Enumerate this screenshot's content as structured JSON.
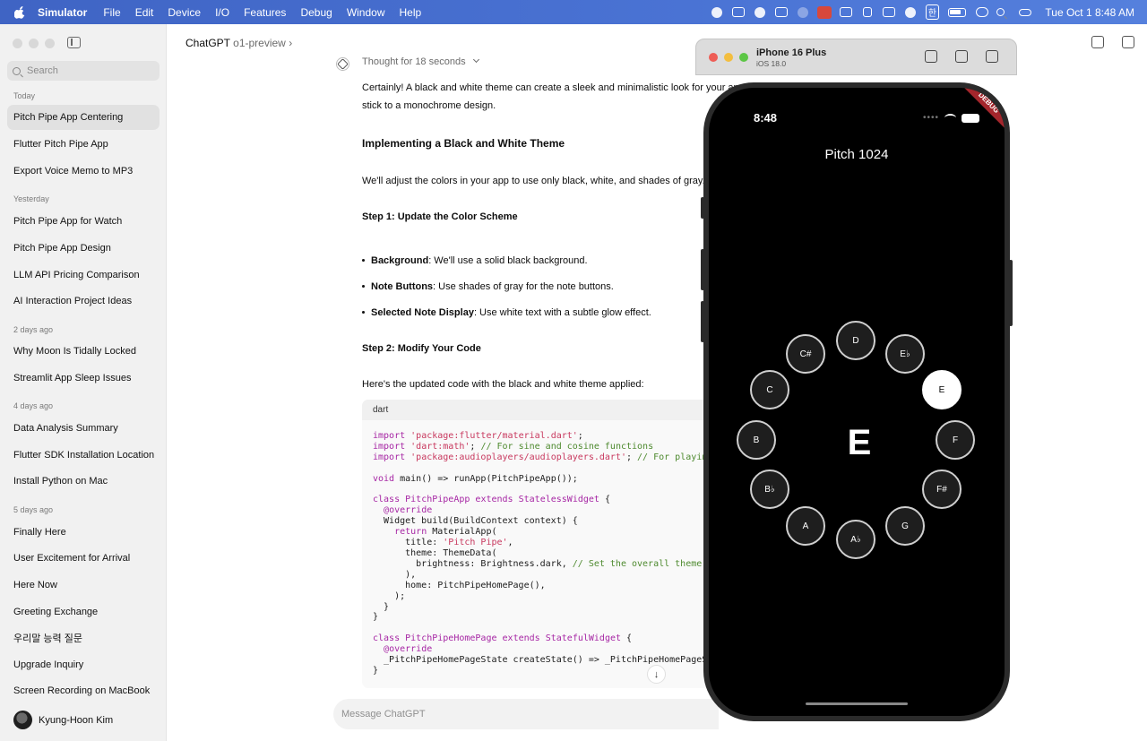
{
  "menubar": {
    "app": "Simulator",
    "items": [
      "File",
      "Edit",
      "Device",
      "I/O",
      "Features",
      "Debug",
      "Window",
      "Help"
    ],
    "ime": "한",
    "clock": "Tue Oct 1  8:48 AM"
  },
  "sidebar": {
    "search_placeholder": "Search",
    "groups": [
      {
        "label": "Today",
        "items": [
          "Pitch Pipe App Centering",
          "Flutter Pitch Pipe App",
          "Export Voice Memo to MP3"
        ]
      },
      {
        "label": "Yesterday",
        "items": [
          "Pitch Pipe App for Watch",
          "Pitch Pipe App Design",
          "LLM API Pricing Comparison",
          "AI Interaction Project Ideas"
        ]
      },
      {
        "label": "2 days ago",
        "items": [
          "Why Moon Is Tidally Locked",
          "Streamlit App Sleep Issues"
        ]
      },
      {
        "label": "4 days ago",
        "items": [
          "Data Analysis Summary",
          "Flutter SDK Installation Location",
          "Install Python on Mac"
        ]
      },
      {
        "label": "5 days ago",
        "items": [
          "Finally Here",
          "User Excitement for Arrival",
          "Here Now",
          "Greeting Exchange",
          "우리말 능력 질문",
          "Upgrade Inquiry",
          "Screen Recording on MacBook"
        ]
      }
    ],
    "user_name": "Kyung-Hoon Kim"
  },
  "main": {
    "title": "ChatGPT",
    "model": "o1-preview",
    "thought": "Thought for 18 seconds",
    "intro_line1": "Certainly! A black and white theme can create a sleek and minimalistic look for your app",
    "intro_line2": "stick to a monochrome design.",
    "heading": "Implementing a Black and White Theme",
    "adjust": "We'll adjust the colors in your app to use only black, white, and shades of gray. T",
    "step1": "Step 1: Update the Color Scheme",
    "bullets": [
      {
        "bold": "Background",
        "text": ": We'll use a solid black background."
      },
      {
        "bold": "Note Buttons",
        "text": ": Use shades of gray for the note buttons."
      },
      {
        "bold": "Selected Note Display",
        "text": ": Use white text with a subtle glow effect."
      }
    ],
    "step2": "Step 2: Modify Your Code",
    "code_intro": "Here's the updated code with the black and white theme applied:",
    "code_lang": "dart",
    "composer_placeholder": "Message ChatGPT"
  },
  "simulator": {
    "device": "iPhone 16 Plus",
    "os": "iOS 18.0"
  },
  "phone": {
    "time": "8:48",
    "debug": "DEBUG",
    "app_title": "Pitch 1024",
    "selected_note": "E",
    "notes": [
      "D",
      "E♭",
      "E",
      "F",
      "F#",
      "G",
      "A♭",
      "A",
      "B♭",
      "B",
      "C",
      "C#"
    ]
  },
  "colors": {
    "menubar": "#4a73d4",
    "sidebar": "#f1f1f1",
    "phone_screen": "#000000",
    "debug_ribbon": "#a4262c"
  }
}
